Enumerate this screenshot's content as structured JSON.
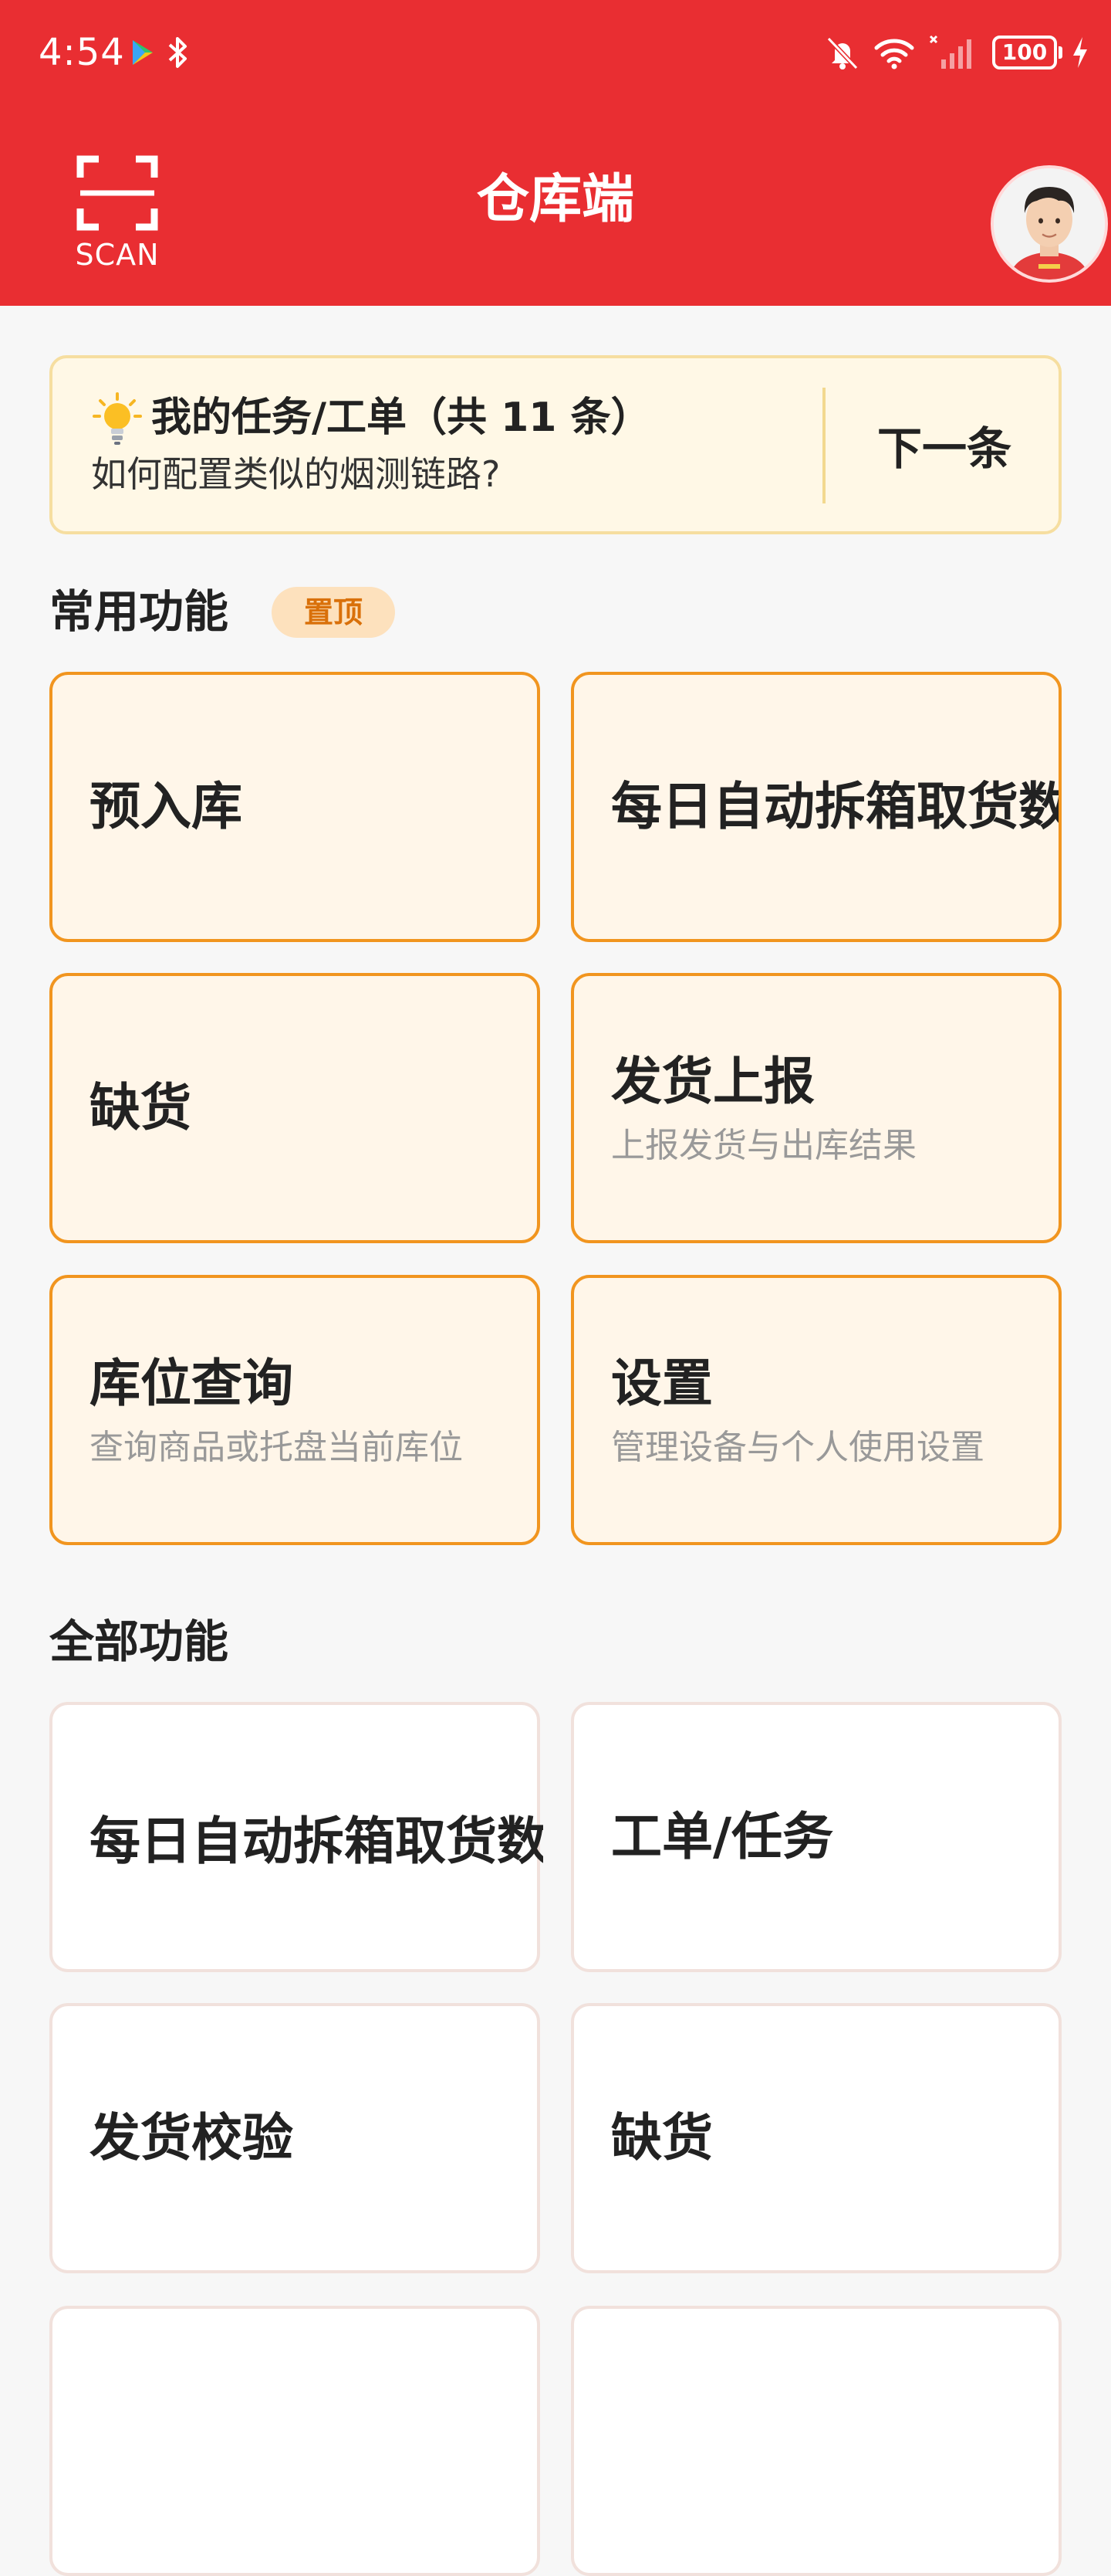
{
  "status_bar": {
    "time": "4:54",
    "battery": "100"
  },
  "header": {
    "scan_label": "SCAN",
    "title": "仓库端"
  },
  "task_banner": {
    "title": "我的任务/工单（共 11 条）",
    "subtitle": "如何配置类似的烟测链路?",
    "next_label": "下一条"
  },
  "favorites": {
    "title": "常用功能",
    "badge": "置顶",
    "tiles": [
      {
        "title": "预入库",
        "subtitle": ""
      },
      {
        "title": "每日自动拆箱取货数",
        "subtitle": ""
      },
      {
        "title": "缺货",
        "subtitle": ""
      },
      {
        "title": "发货上报",
        "subtitle": "上报发货与出库结果"
      },
      {
        "title": "库位查询",
        "subtitle": "查询商品或托盘当前库位"
      },
      {
        "title": "设置",
        "subtitle": "管理设备与个人使用设置"
      }
    ]
  },
  "all_functions": {
    "title": "全部功能",
    "tiles": [
      {
        "title": "每日自动拆箱取货数",
        "subtitle": ""
      },
      {
        "title": "工单/任务",
        "subtitle": ""
      },
      {
        "title": "发货校验",
        "subtitle": ""
      },
      {
        "title": "缺货",
        "subtitle": ""
      },
      {
        "title": "",
        "subtitle": ""
      },
      {
        "title": "",
        "subtitle": ""
      }
    ]
  },
  "colors": {
    "brand_red": "#e92e32",
    "favorite_border": "#f1951f",
    "favorite_bg": "#fff6e9",
    "banner_bg": "#fff8e6",
    "badge_text": "#d9700a"
  },
  "icons": {
    "scan": "scan-icon",
    "bulb": "lightbulb-icon",
    "avatar": "user-avatar"
  }
}
